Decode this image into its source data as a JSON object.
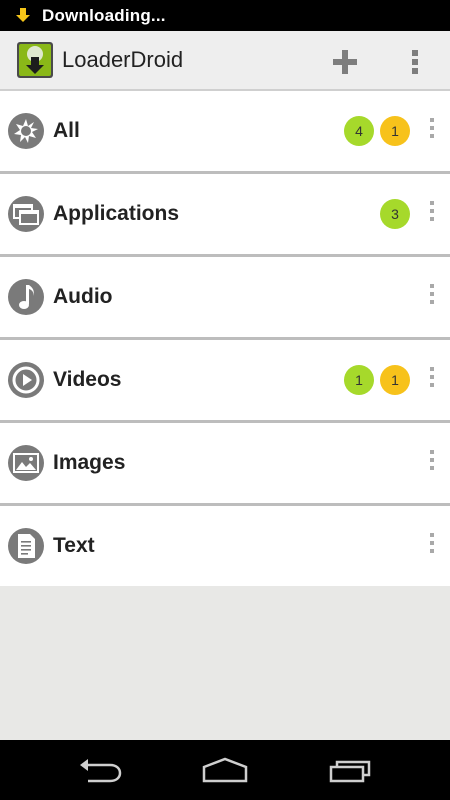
{
  "status": {
    "text": "Downloading...",
    "icon": "download-arrow-icon"
  },
  "app": {
    "title": "LoaderDroid"
  },
  "toolbar": {
    "add_icon": "plus-icon",
    "overflow_icon": "more-vertical-icon"
  },
  "categories": [
    {
      "label": "All",
      "icon": "all-burst-icon",
      "badges": [
        {
          "value": "4",
          "color": "#a6d92b"
        },
        {
          "value": "1",
          "color": "#f7c21b"
        }
      ]
    },
    {
      "label": "Applications",
      "icon": "applications-icon",
      "badges": [
        {
          "value": "3",
          "color": "#a6d92b"
        }
      ]
    },
    {
      "label": "Audio",
      "icon": "music-note-icon",
      "badges": []
    },
    {
      "label": "Videos",
      "icon": "play-icon",
      "badges": [
        {
          "value": "1",
          "color": "#a6d92b"
        },
        {
          "value": "1",
          "color": "#f7c21b"
        }
      ]
    },
    {
      "label": "Images",
      "icon": "image-icon",
      "badges": []
    },
    {
      "label": "Text",
      "icon": "document-icon",
      "badges": []
    }
  ],
  "navbar": {
    "back_icon": "back-icon",
    "home_icon": "home-icon",
    "recents_icon": "recent-apps-icon"
  }
}
